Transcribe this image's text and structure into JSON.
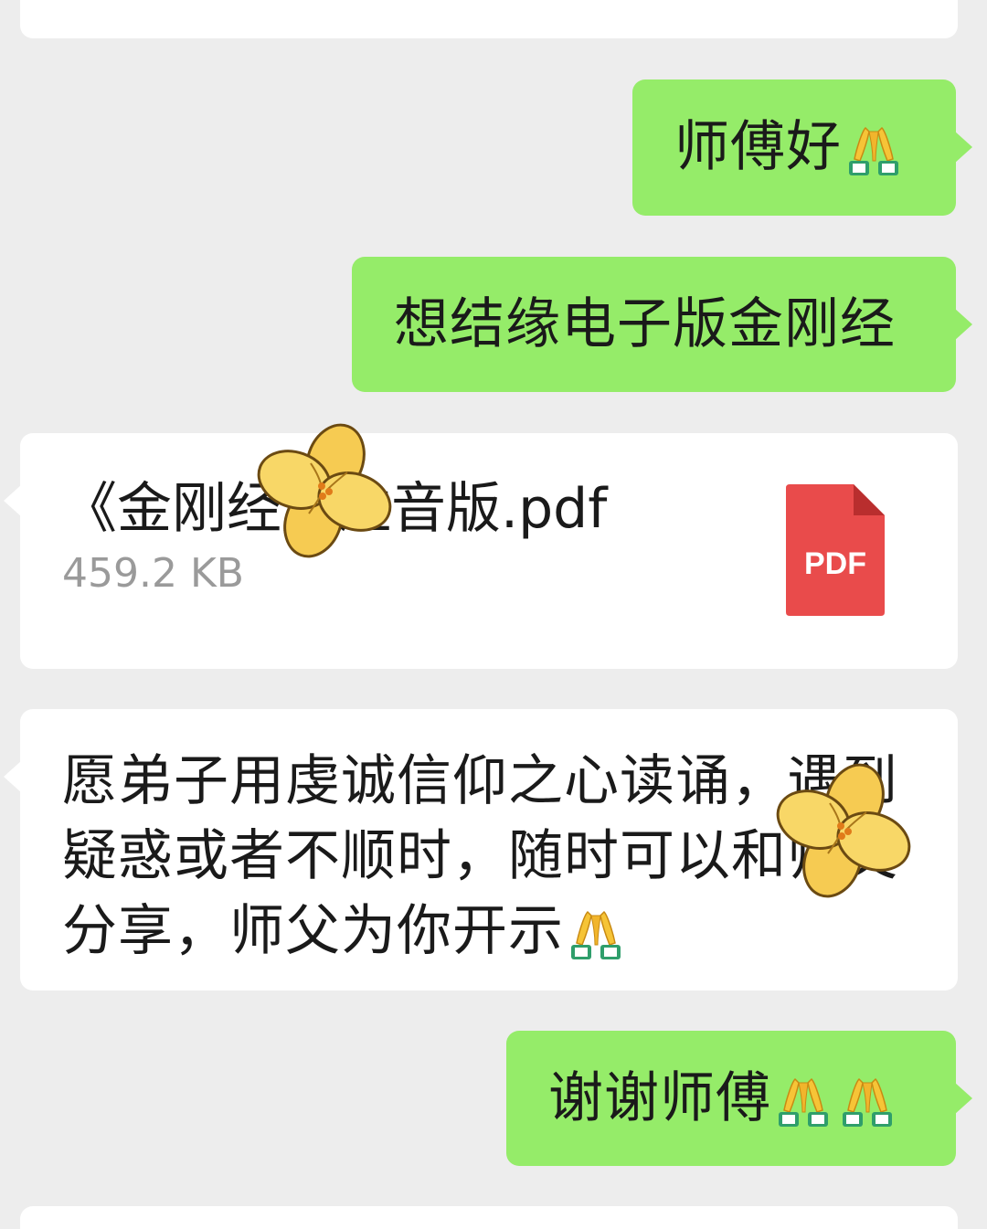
{
  "messages": [
    {
      "id": "m1",
      "side": "me",
      "text": "师傅好"
    },
    {
      "id": "m2",
      "side": "me",
      "text": "想结缘电子版金刚经"
    },
    {
      "id": "m3",
      "side": "them",
      "type": "file",
      "file_name": "《金刚经》注音版.pdf",
      "file_size": "459.2 KB",
      "file_icon_label": "PDF"
    },
    {
      "id": "m4",
      "side": "them",
      "text": "愿弟子用虔诚信仰之心读诵，遇到疑惑或者不顺时，随时可以和师父分享，师父为你开示"
    },
    {
      "id": "m5",
      "side": "me",
      "text": "谢谢师傅"
    }
  ],
  "icons": {
    "pray": "folded-hands-emoji",
    "sticker": "yellow-flower-sticker",
    "file": "pdf-file-icon"
  },
  "colors": {
    "background": "#ededed",
    "sent_bubble": "#95ec69",
    "received_bubble": "#ffffff",
    "pdf_red": "#e94b4b"
  }
}
